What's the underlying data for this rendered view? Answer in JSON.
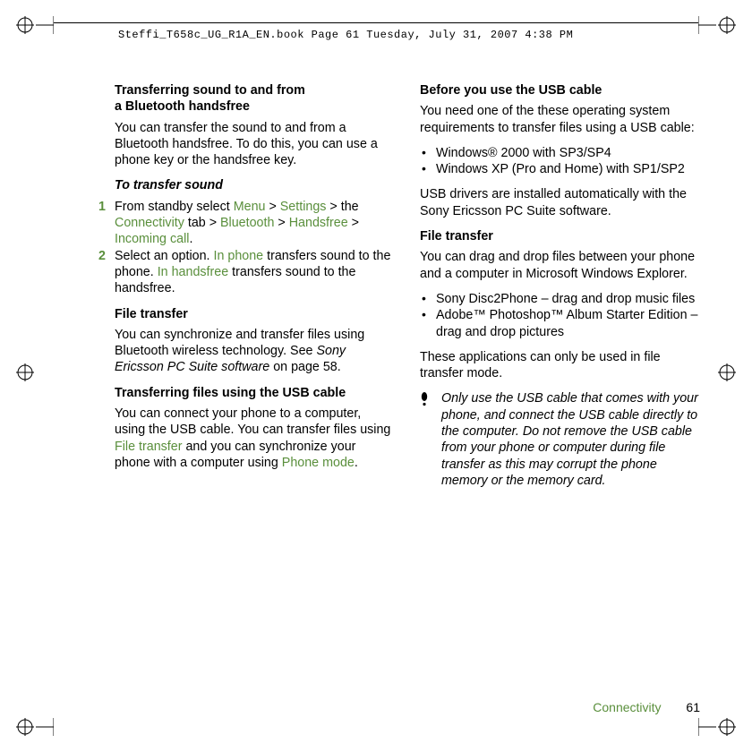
{
  "header": {
    "filename_line": "Steffi_T658c_UG_R1A_EN.book  Page 61  Tuesday, July 31, 2007  4:38 PM"
  },
  "left": {
    "h1a": "Transferring sound to and from",
    "h1b": "a Bluetooth handsfree",
    "p1": "You can transfer the sound to and from a Bluetooth handsfree. To do this, you can use a phone key or the handsfree key.",
    "h2": "To transfer sound",
    "step1_pre": "From standby select ",
    "step1_menu": "Menu",
    "step1_gt1": " > ",
    "step1_settings": "Settings",
    "step1_gt2": " > the ",
    "step1_conn": "Connectivity",
    "step1_tab": " tab > ",
    "step1_bt": "Bluetooth",
    "step1_gt3": " > ",
    "step1_hf": "Handsfree",
    "step1_gt4": " > ",
    "step1_inc": "Incoming call",
    "step1_dot": ".",
    "step2_pre": "Select  an option. ",
    "step2_inphone": "In phone",
    "step2_mid": " transfers sound to the phone. ",
    "step2_inhf": "In handsfree",
    "step2_post": " transfers sound to the handsfree.",
    "h3": "File transfer",
    "p3a": "You can synchronize and transfer files using Bluetooth wireless technology. See ",
    "p3i": "Sony Ericsson PC Suite software",
    "p3b": " on page 58.",
    "h4": "Transferring files using the USB cable",
    "p4a": "You can connect your phone to a computer, using the USB cable. You can transfer files using ",
    "p4g1": "File transfer",
    "p4b": " and you can synchronize your phone with a computer using ",
    "p4g2": "Phone mode",
    "p4c": "."
  },
  "right": {
    "h1": "Before you use the USB cable",
    "p1": "You need one of the these operating system requirements to transfer files using a USB cable:",
    "li1": "Windows® 2000 with SP3/SP4",
    "li2": "Windows XP (Pro and Home) with SP1/SP2",
    "p2": "USB drivers are installed automatically with the Sony Ericsson PC Suite software.",
    "h2": "File transfer",
    "p3": "You can drag and drop files between your phone and a computer in Microsoft Windows Explorer.",
    "li3": "Sony Disc2Phone – drag and drop music files",
    "li4": "Adobe™ Photoshop™ Album Starter Edition – drag and drop pictures",
    "p4": "These applications can only be used in file transfer mode.",
    "warn": "Only use the USB cable that comes with your phone, and connect the USB cable directly to the computer. Do not remove the USB cable from your phone or computer during file transfer as this may corrupt the phone memory or the memory card."
  },
  "footer": {
    "section": "Connectivity",
    "page": "61"
  }
}
